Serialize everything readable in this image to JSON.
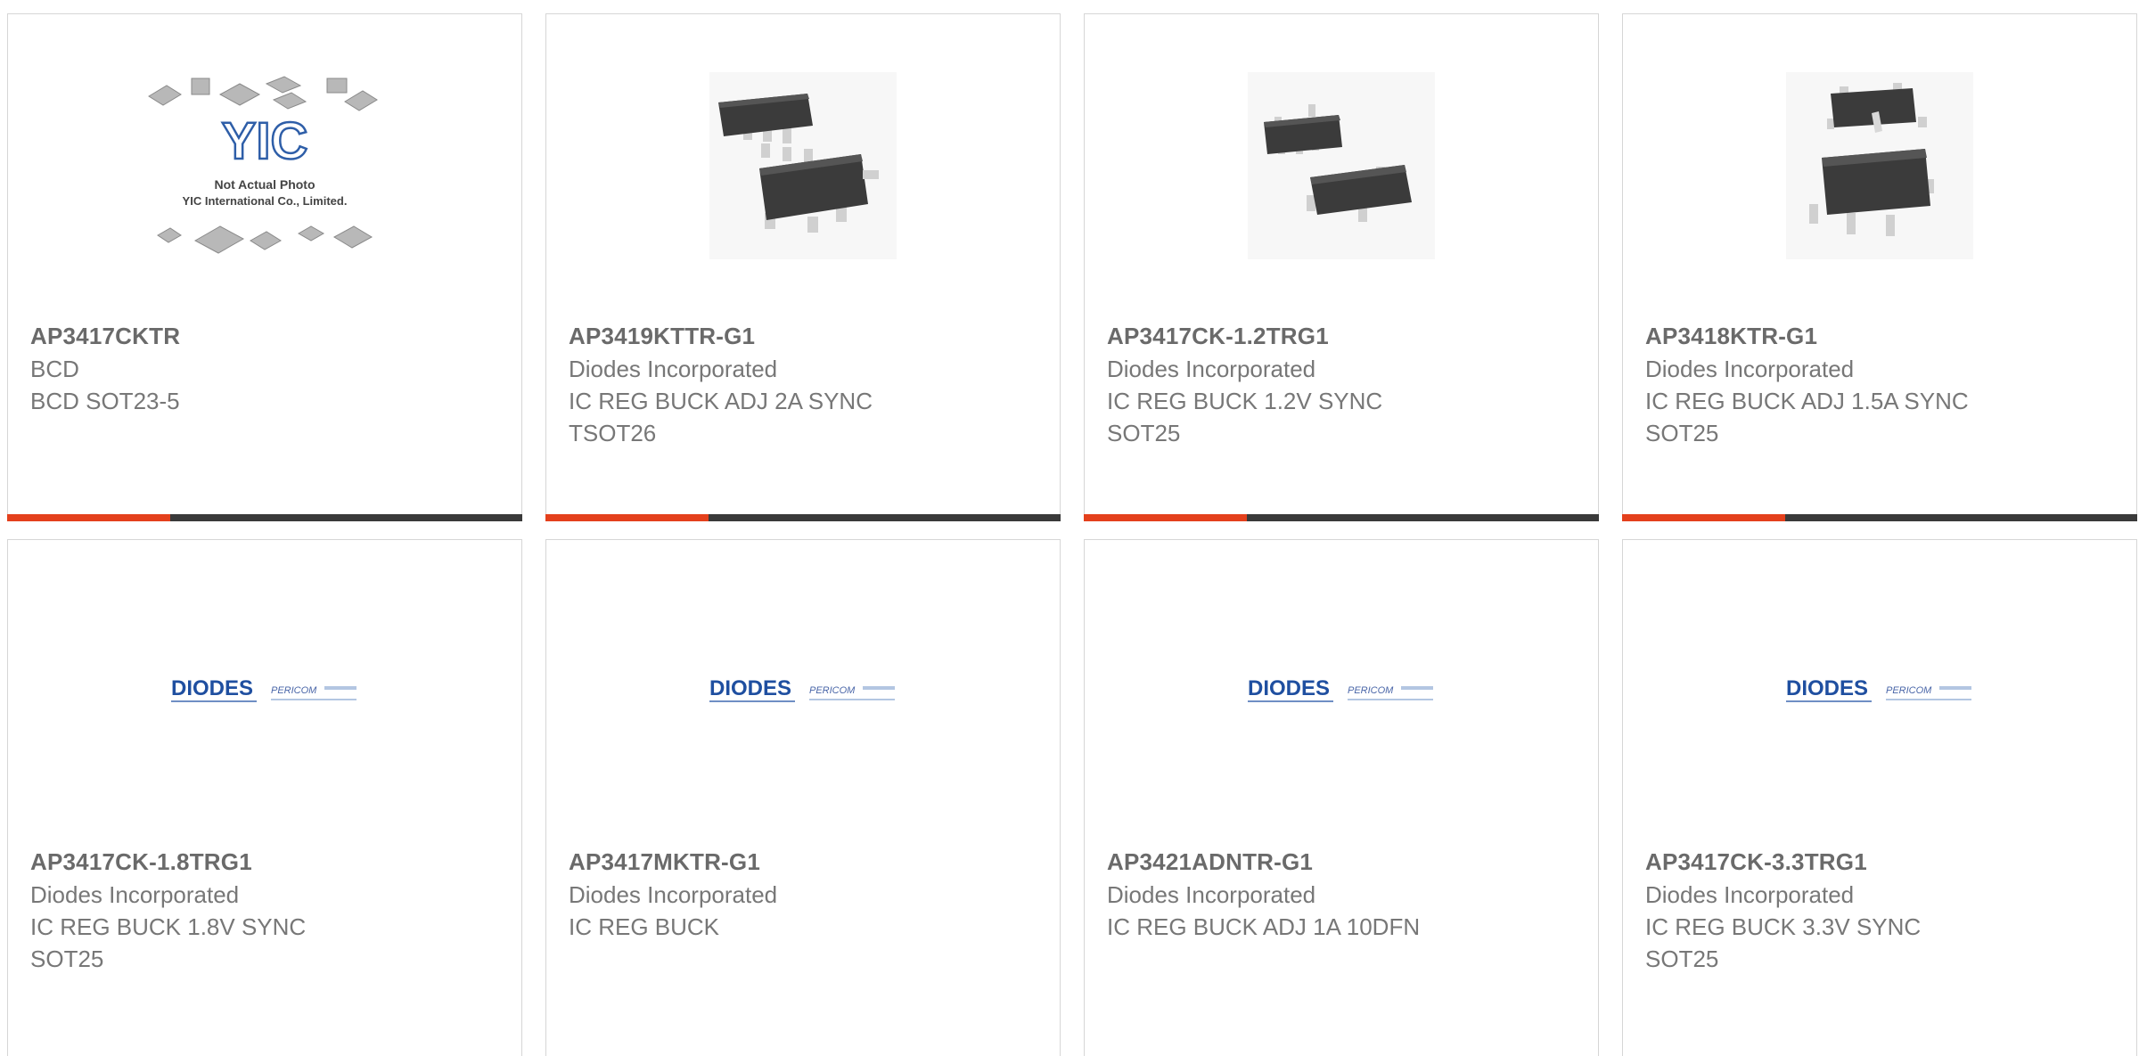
{
  "colors": {
    "accent": "#e4401c",
    "bar": "#3a3a3a",
    "border": "#d6d6d6",
    "diodes_blue": "#1f4fa0"
  },
  "products": [
    {
      "part": "AP3417CKTR",
      "manufacturer": "BCD",
      "description": "BCD SOT23-5",
      "image": "placeholder-photo",
      "image_text_1": "Not Actual Photo",
      "image_text_2": "YIC International Co., Limited.",
      "logo_text": "YIC"
    },
    {
      "part": "AP3419KTTR-G1",
      "manufacturer": "Diodes Incorporated",
      "description": "IC REG BUCK ADJ 2A SYNC\nTSOT26",
      "image": "chip-photo"
    },
    {
      "part": "AP3417CK-1.2TRG1",
      "manufacturer": "Diodes Incorporated",
      "description": "IC REG BUCK 1.2V SYNC\nSOT25",
      "image": "chip-photo"
    },
    {
      "part": "AP3418KTR-G1",
      "manufacturer": "Diodes Incorporated",
      "description": "IC REG BUCK ADJ 1.5A SYNC\nSOT25",
      "image": "chip-photo"
    },
    {
      "part": "AP3417CK-1.8TRG1",
      "manufacturer": "Diodes Incorporated",
      "description": "IC REG BUCK 1.8V SYNC\nSOT25",
      "image": "brand-logo",
      "logo_main": "DIODES",
      "logo_sub": "PERICOM"
    },
    {
      "part": "AP3417MKTR-G1",
      "manufacturer": "Diodes Incorporated",
      "description": "IC REG BUCK",
      "image": "brand-logo",
      "logo_main": "DIODES",
      "logo_sub": "PERICOM"
    },
    {
      "part": "AP3421ADNTR-G1",
      "manufacturer": "Diodes Incorporated",
      "description": "IC REG BUCK ADJ 1A 10DFN",
      "image": "brand-logo",
      "logo_main": "DIODES",
      "logo_sub": "PERICOM"
    },
    {
      "part": "AP3417CK-3.3TRG1",
      "manufacturer": "Diodes Incorporated",
      "description": "IC REG BUCK 3.3V SYNC\nSOT25",
      "image": "brand-logo",
      "logo_main": "DIODES",
      "logo_sub": "PERICOM"
    }
  ]
}
